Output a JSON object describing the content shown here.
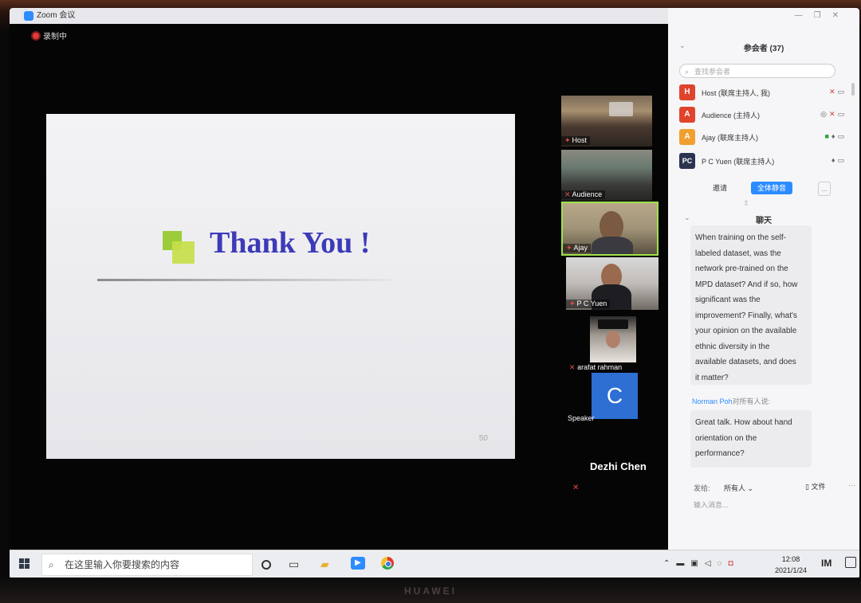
{
  "window": {
    "title": "Zoom 会议",
    "recording": "录制中"
  },
  "slide": {
    "heading": "Thank You !",
    "page_number": "50"
  },
  "videos": [
    {
      "name": "Host",
      "muted": false
    },
    {
      "name": "Audience",
      "muted": true
    },
    {
      "name": "Ajay",
      "muted": false
    },
    {
      "name": "P C Yuen",
      "muted": false
    },
    {
      "name": "arafat rahman",
      "muted": true
    }
  ],
  "speaker": {
    "initial": "C",
    "label": "Speaker",
    "name": "Dezhi Chen"
  },
  "participants_panel": {
    "title": "参会者 (37)",
    "search_placeholder": "查找参会者",
    "participants": [
      {
        "initials": "H",
        "name": "Host (联席主持人, 我)",
        "color": "#e0442c"
      },
      {
        "initials": "A",
        "name": "Audience (主持人)",
        "color": "#e0442c"
      },
      {
        "initials": "A",
        "name": "Ajay (联席主持人)",
        "color": "#f0a030"
      },
      {
        "initials": "PC",
        "name": "P C Yuen (联席主持人)",
        "color": "#2b3550"
      }
    ],
    "invite_label": "邀请",
    "mute_all_label": "全体静音",
    "more_label": "..."
  },
  "chat": {
    "title": "聊天",
    "messages": [
      {
        "lines": [
          "When training on the self-",
          "labeled dataset, was the",
          "network pre-trained on the",
          "MPD dataset? And if so, how",
          "significant was the",
          "improvement? Finally, what's",
          "your opinion on the available",
          "ethnic diversity in the",
          "available datasets, and does",
          "it matter?"
        ]
      },
      {
        "sender": "Norman Poh",
        "sender_suffix": "对所有人说:",
        "lines": [
          "Great talk. How about hand",
          "orientation on the",
          "performance?"
        ]
      }
    ],
    "send_to_label": "发给:",
    "send_to_value": "所有人",
    "file_label": "文件",
    "input_placeholder": "输入消息..."
  },
  "taskbar": {
    "search_placeholder": "在这里输入你要搜索的内容",
    "time": "12:08",
    "date": "2021/1/24",
    "ime": "IM"
  },
  "device": {
    "brand": "HUAWEI"
  },
  "colors": {
    "zoom_blue": "#2d8cff",
    "slide_title": "#3d3ab8",
    "active_speaker_border": "#9ee24a"
  }
}
